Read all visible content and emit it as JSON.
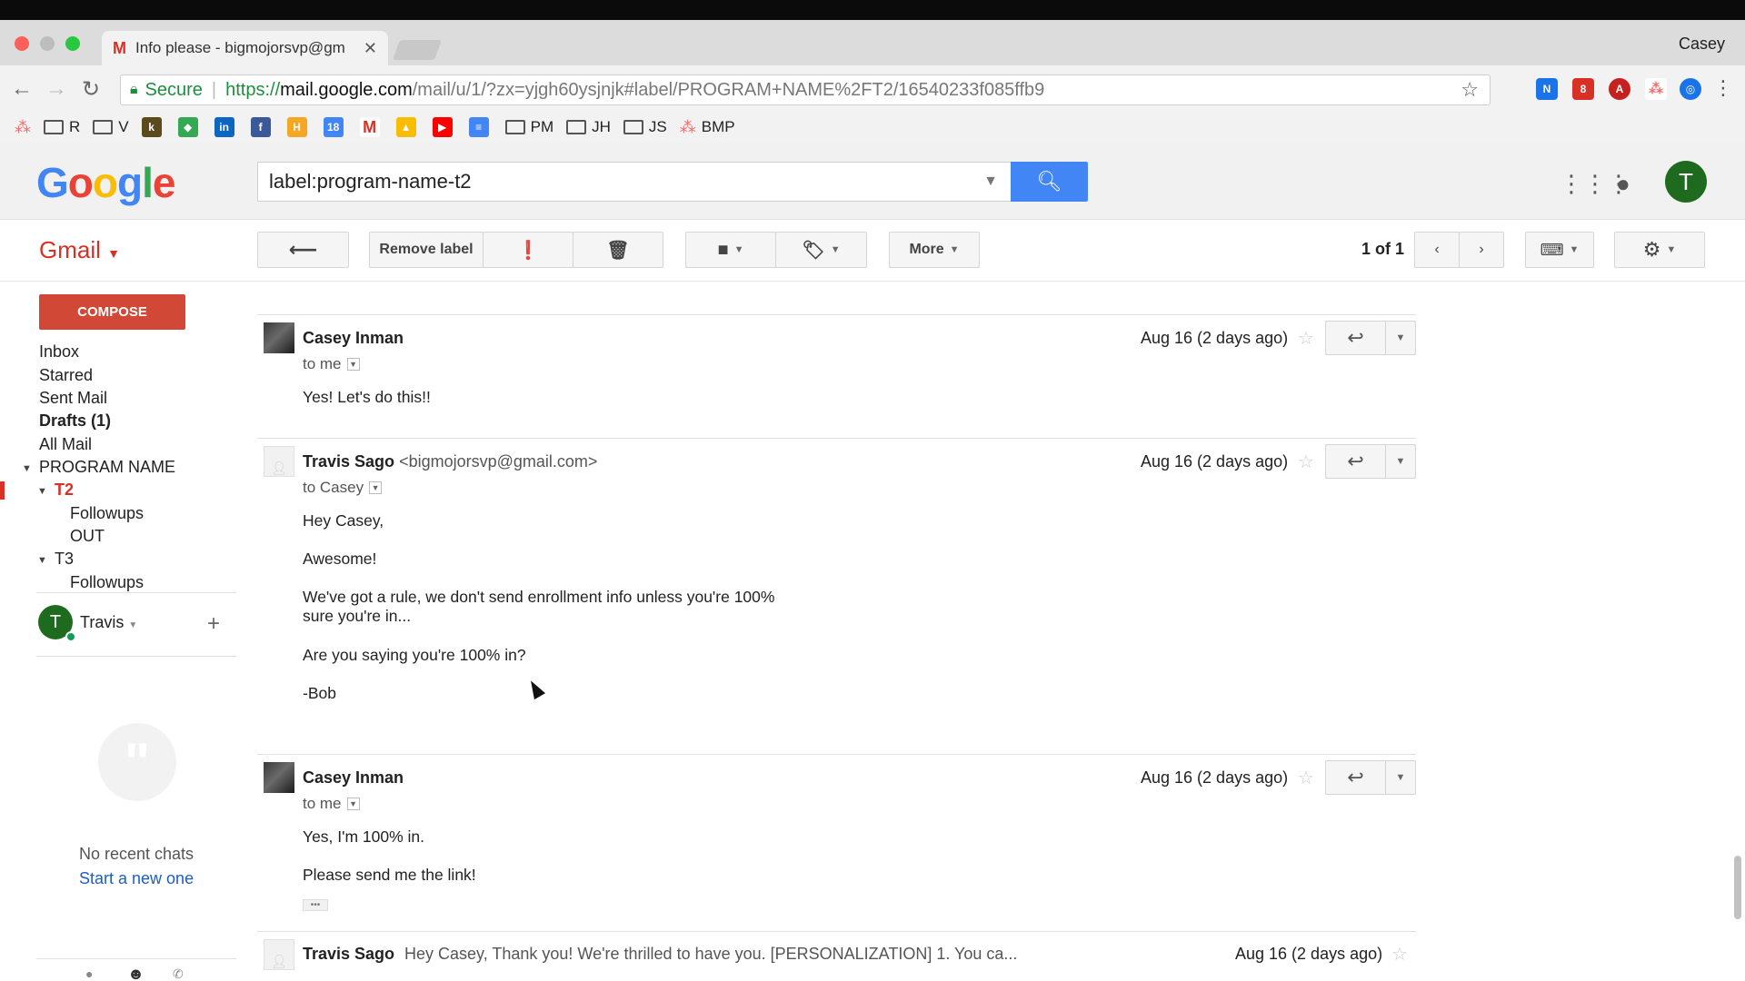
{
  "browser": {
    "tab_title": "Info please - bigmojorsvp@gm",
    "profile_name": "Casey",
    "secure_label": "Secure",
    "url_protocol": "https://",
    "url_host": "mail.google.com",
    "url_path": "/mail/u/1/?zx=yjgh60ysjnjk#label/PROGRAM+NAME%2FT2/16540233f085ffb9",
    "bookmarks": [
      "R",
      "V",
      "PM",
      "JH",
      "JS",
      "BMP"
    ]
  },
  "header": {
    "search_query": "label:program-name-t2",
    "avatar_letter": "T"
  },
  "toolbar": {
    "gmail_label": "Gmail",
    "remove_label": "Remove label",
    "more_label": "More",
    "pager_range": "1 of 1"
  },
  "sidebar": {
    "compose": "COMPOSE",
    "items": [
      "Inbox",
      "Starred",
      "Sent Mail",
      "Drafts (1)",
      "All Mail"
    ],
    "program_name": "PROGRAM NAME",
    "t2": "T2",
    "t2_children": [
      "Followups",
      "OUT"
    ],
    "t3": "T3",
    "t3_children": [
      "Followups"
    ],
    "hangouts_user": "Travis",
    "hangouts_letter": "T",
    "no_chats": "No recent chats",
    "start_new": "Start a new one"
  },
  "messages": [
    {
      "sender": "Casey Inman",
      "sender_email": "",
      "to": "to me",
      "date": "Aug 16 (2 days ago)",
      "body": [
        "Yes! Let's do this!!"
      ]
    },
    {
      "sender": "Travis Sago",
      "sender_email": "<bigmojorsvp@gmail.com>",
      "to": "to Casey",
      "date": "Aug 16 (2 days ago)",
      "body": [
        "Hey Casey,",
        "Awesome!",
        "We've got a rule, we don't send enrollment info unless you're 100%",
        "sure you're in...",
        "Are you saying you're 100% in?",
        "-Bob"
      ]
    },
    {
      "sender": "Casey Inman",
      "sender_email": "",
      "to": "to me",
      "date": "Aug 16 (2 days ago)",
      "body": [
        "Yes, I'm 100% in.",
        "Please send me the link!"
      ]
    },
    {
      "sender": "Travis Sago",
      "snippet": "Hey Casey, Thank you! We're thrilled to have you. [PERSONALIZATION] 1. You ca...",
      "date": "Aug 16 (2 days ago)"
    }
  ],
  "colors": {
    "gmail_red": "#d93025",
    "search_blue": "#4285f4",
    "avatar_green": "#1e6b1f",
    "compose_red": "#d14836"
  }
}
